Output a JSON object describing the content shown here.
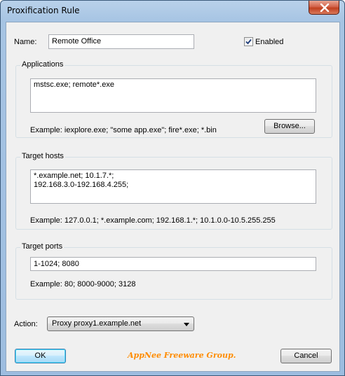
{
  "window": {
    "title": "Proxification Rule"
  },
  "name_row": {
    "label": "Name:",
    "value": "Remote Office",
    "enabled_label": "Enabled",
    "enabled_checked": true
  },
  "applications": {
    "group_label": "Applications",
    "value": "mstsc.exe; remote*.exe",
    "example": "Example: iexplore.exe; \"some app.exe\"; fire*.exe; *.bin",
    "browse_label": "Browse..."
  },
  "target_hosts": {
    "group_label": "Target hosts",
    "value": "*.example.net; 10.1.7.*;\n192.168.3.0-192.168.4.255;",
    "example": "Example: 127.0.0.1; *.example.com; 192.168.1.*; 10.1.0.0-10.5.255.255"
  },
  "target_ports": {
    "group_label": "Target ports",
    "value": "1-1024; 8080",
    "example": "Example: 80; 8000-9000; 3128"
  },
  "action": {
    "label": "Action:",
    "selected": "Proxy proxy1.example.net"
  },
  "buttons": {
    "ok_label": "OK",
    "cancel_label": "Cancel"
  },
  "watermark": "AppNee Freeware Group.",
  "colors": {
    "title_bar": "#a6c4e3",
    "close_button": "#c0401f",
    "watermark": "#ff8c00",
    "dialog_bg": "#f0f0f0"
  }
}
